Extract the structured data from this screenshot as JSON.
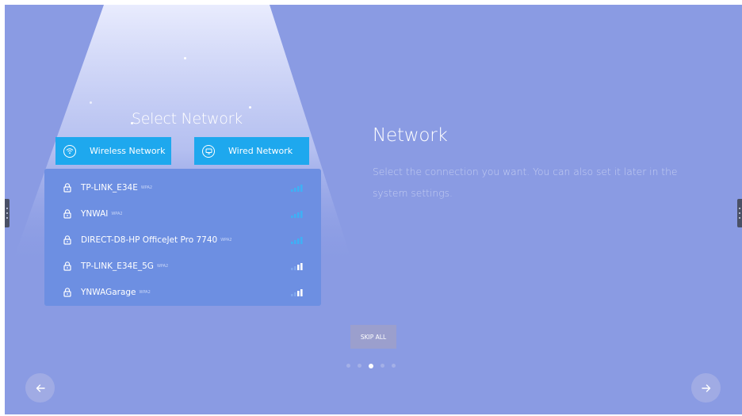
{
  "select_title": "Select Network",
  "tabs": [
    {
      "label": "Wireless Network",
      "icon": "wifi-icon"
    },
    {
      "label": "Wired Network",
      "icon": "monitor-icon"
    }
  ],
  "networks": [
    {
      "ssid": "TP-LINK_E34E",
      "security": "WPA2",
      "signal_bars": 4
    },
    {
      "ssid": "YNWAI",
      "security": "WPA2",
      "signal_bars": 4
    },
    {
      "ssid": "DIRECT-D8-HP OfficeJet Pro 7740",
      "security": "WPA2",
      "signal_bars": 4
    },
    {
      "ssid": "TP-LINK_E34E_5G",
      "security": "WPA2",
      "signal_bars": 2
    },
    {
      "ssid": "YNWAGarage",
      "security": "WPA2",
      "signal_bars": 2
    }
  ],
  "heading": "Network",
  "description": "Select the connection you want. You can also set it later in the system settings.",
  "skip_label": "SKIP ALL",
  "pagination": {
    "total": 5,
    "current": 3
  },
  "colors": {
    "background": "#8a9be3",
    "accent": "#1ea8ee",
    "panel": "#6d8fe2",
    "signal_on": "#3fb0f5"
  },
  "icons": {
    "prev": "arrow-left-icon",
    "next": "arrow-right-icon",
    "lock": "lock-icon",
    "signal": "signal-icon"
  }
}
